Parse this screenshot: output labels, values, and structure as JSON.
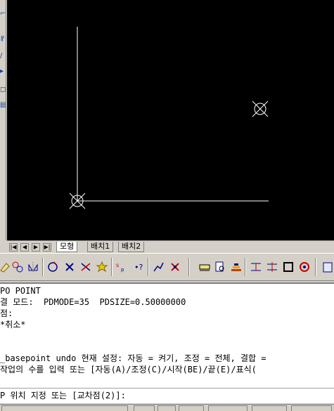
{
  "layout_tabs": {
    "model": "모형",
    "layout1": "배치1",
    "layout2": "배치2"
  },
  "command_history": [
    "PO POINT",
    "결 모드:  PDMODE=35  PDSIZE=0.50000000",
    "점:",
    "*취소*",
    "",
    "",
    "_basepoint undo 현재 설정: 자동 = 켜기, 조정 = 전체, 결합 = ",
    "작업의 수를 입력 또는 [자동(A)/조정(C)/시작(BE)/끝(E)/표식("
  ],
  "command_prompt": "P 위치 지정 또는 [교차점(2)]:",
  "colors": {
    "canvas": "#000000",
    "geometry": "#ffffff",
    "chrome": "#d4d0c8"
  },
  "icons": {
    "toolbar": [
      "erase-icon",
      "copy-icon",
      "mirror-icon",
      "rotate-icon",
      "delete-icon",
      "trim-icon",
      "extend-icon",
      "scale-icon",
      "question-icon",
      "stretch-icon",
      "explode-icon",
      "dimension-icon",
      "view-icon",
      "layer-icon",
      "insert-icon",
      "block-icon",
      "frame-icon",
      "snap-icon",
      "properties-icon"
    ]
  }
}
